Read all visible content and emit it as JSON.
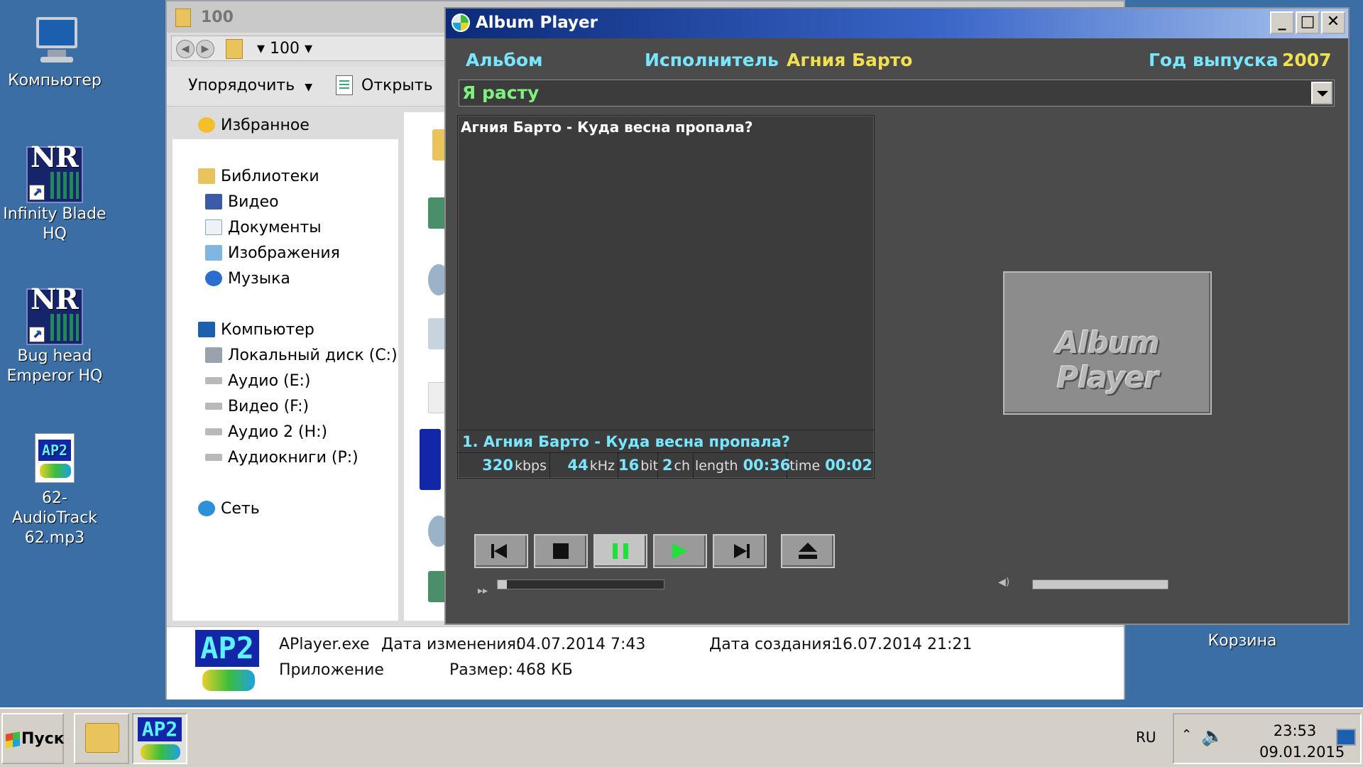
{
  "desktop": {
    "icons": [
      {
        "label": "Компьютер"
      },
      {
        "label": "Infinity Blade HQ"
      },
      {
        "label": "Bug head Emperor HQ"
      },
      {
        "label": "62-AudioTrack 62.mp3"
      }
    ],
    "nr_logo_text": "NR",
    "recycle_bin_label": "Корзина"
  },
  "explorer": {
    "title": "100",
    "address": "▾ 100 ▾",
    "toolbar": {
      "organize": "Упорядочить",
      "open": "Открыть"
    },
    "nav": {
      "favorites": "Избранное",
      "libraries": "Библиотеки",
      "video": "Видео",
      "documents": "Документы",
      "images": "Изображения",
      "music": "Музыка",
      "computer": "Компьютер",
      "local_disk": "Локальный диск (C:)",
      "audio_e": "Аудио (E:)",
      "video_f": "Видео (F:)",
      "audio2_h": "Аудио 2 (H:)",
      "audiobooks_p": "Аудиокниги (P:)",
      "network": "Сеть"
    },
    "details": {
      "filename": "APlayer.exe",
      "modified_label": "Дата изменения:",
      "modified_value": "04.07.2014 7:43",
      "created_label": "Дата создания:",
      "created_value": "16.07.2014 21:21",
      "type": "Приложение",
      "size_label": "Размер:",
      "size_value": "468 КБ"
    }
  },
  "player": {
    "title": "Album Player",
    "window_buttons": {
      "minimize": "_",
      "maximize": "□",
      "close": "✕"
    },
    "album_label": "Альбом",
    "artist_label": "Исполнитель",
    "artist_value": "Агния Барто",
    "year_label": "Год выпуска",
    "year_value": "2007",
    "album_value": "Я расту",
    "playlist": [
      "Агния Барто - Куда весна пропала?"
    ],
    "now_playing": "1.  Агния Барто - Куда весна пропала?",
    "stats": {
      "bitrate": "320",
      "bitrate_unit": "kbps",
      "rate": "44",
      "rate_unit": "kHz",
      "bits": "16",
      "bits_unit": "bit",
      "channels": "2",
      "channels_unit": "ch",
      "length_label": "length",
      "length": "00:36",
      "time_label": "time",
      "time": "00:02"
    },
    "cover_text": "Album Player",
    "progress_fraction": 0.056,
    "volume_fraction": 1.0
  },
  "taskbar": {
    "start": "Пуск",
    "lang": "RU",
    "time": "23:53",
    "date": "09.01.2015"
  },
  "colors": {
    "desktop": "#3a6ea5",
    "player_bg": "#4b4b4b",
    "label_cyan": "#78e6ff",
    "value_yellow": "#f0e050",
    "album_green": "#7ef27e",
    "play_green": "#22e03a"
  }
}
